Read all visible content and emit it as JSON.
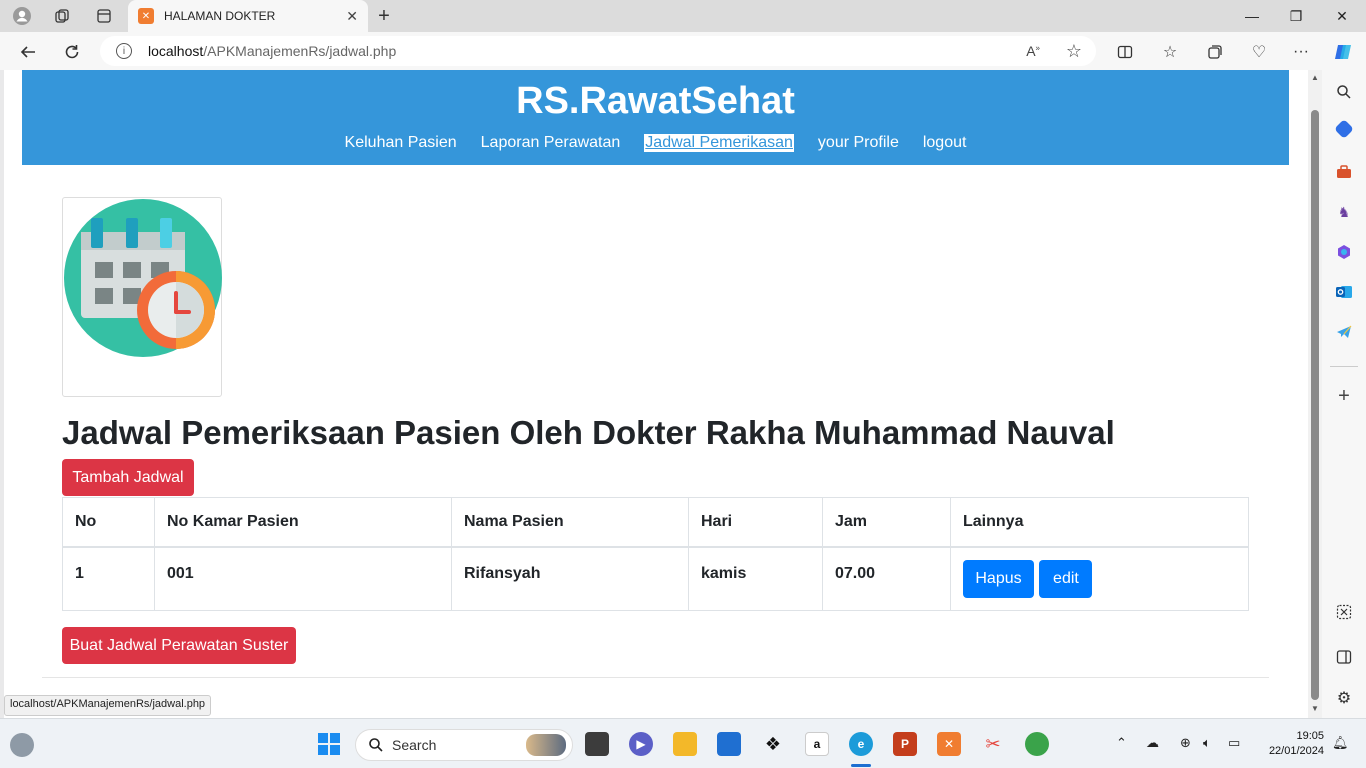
{
  "browser": {
    "tab_title": "HALAMAN DOKTER",
    "tab_close": "✕",
    "new_tab": "+",
    "url_host": "localhost",
    "url_path": "/APKManajemenRs/jadwal.php",
    "status_url": "localhost/APKManajemenRs/jadwal.php"
  },
  "header": {
    "title": "RS.RawatSehat",
    "nav": [
      {
        "label": "Keluhan Pasien"
      },
      {
        "label": "Laporan Perawatan"
      },
      {
        "label": "Jadwal Pemerikasan"
      },
      {
        "label": "your Profile"
      },
      {
        "label": "logout"
      }
    ]
  },
  "main": {
    "heading_prefix": "Jadwal Pemeriksaan Pasien Oleh Dokter ",
    "heading_doctor": "Rakha Muhammad Nauval",
    "add_button": "Tambah Jadwal",
    "table": {
      "headers": [
        "No",
        "No Kamar Pasien",
        "Nama Pasien",
        "Hari",
        "Jam",
        "Lainnya"
      ],
      "rows": [
        {
          "no": "1",
          "kamar": "001",
          "nama": "Rifansyah",
          "hari": "kamis",
          "jam": "07.00",
          "hapus": "Hapus",
          "edit": "edit"
        }
      ]
    },
    "nurse_button": "Buat Jadwal Perawatan Suster"
  },
  "taskbar": {
    "search_placeholder": "Search",
    "time": "19:05",
    "date": "22/01/2024"
  },
  "colors": {
    "header_bg": "#3596da",
    "danger": "#dc3545",
    "primary": "#007bff"
  }
}
